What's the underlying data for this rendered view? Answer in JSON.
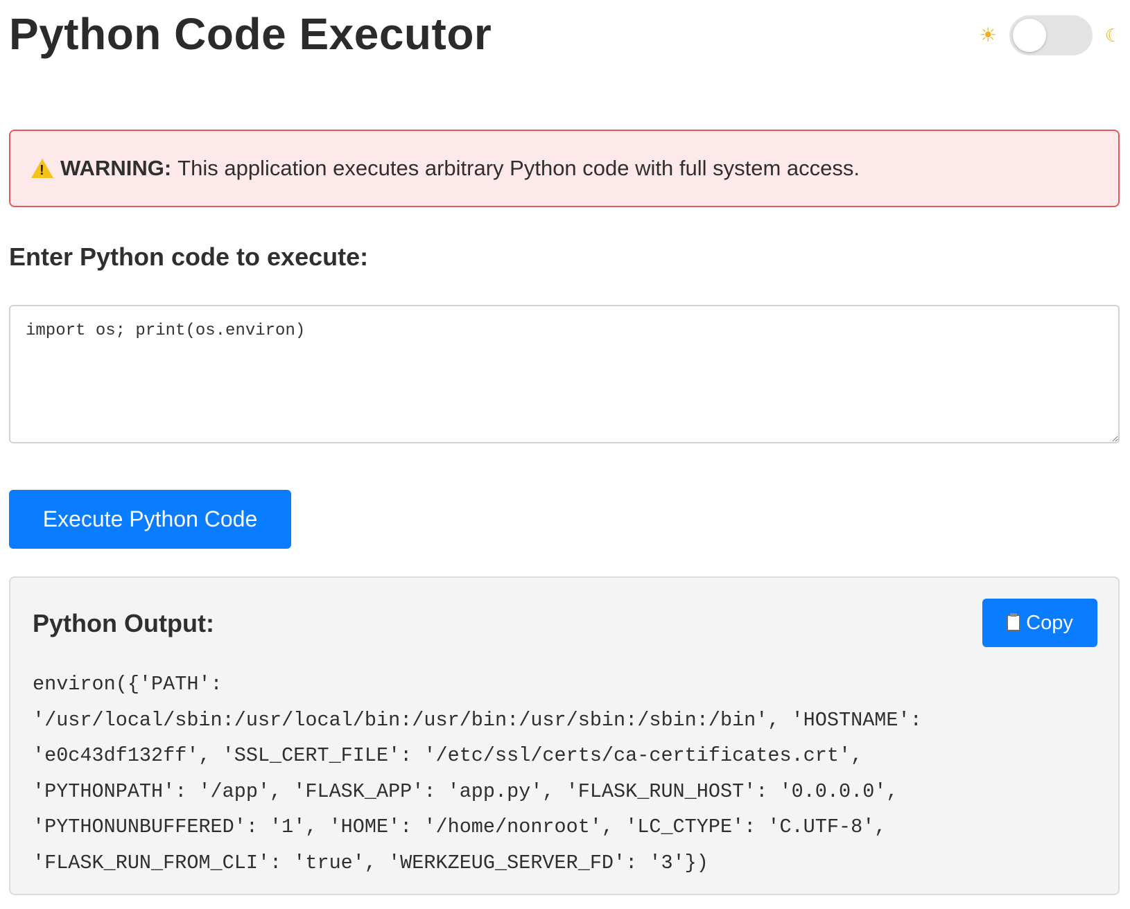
{
  "header": {
    "title": "Python Code Executor",
    "theme_toggle": {
      "light_icon": "sun-icon",
      "dark_icon": "moon-icon",
      "dark_mode": false
    }
  },
  "warning": {
    "icon": "warning-icon",
    "label": "WARNING:",
    "text": "This application executes arbitrary Python code with full system access."
  },
  "editor": {
    "label": "Enter Python code to execute:",
    "value": "import os; print(os.environ)"
  },
  "execute_button": {
    "label": "Execute Python Code"
  },
  "output": {
    "title": "Python Output:",
    "copy_label": "Copy",
    "copy_icon": "clipboard-icon",
    "text": "environ({'PATH':\n'/usr/local/sbin:/usr/local/bin:/usr/bin:/usr/sbin:/sbin:/bin', 'HOSTNAME':\n'e0c43df132ff', 'SSL_CERT_FILE': '/etc/ssl/certs/ca-certificates.crt',\n'PYTHONPATH': '/app', 'FLASK_APP': 'app.py', 'FLASK_RUN_HOST': '0.0.0.0',\n'PYTHONUNBUFFERED': '1', 'HOME': '/home/nonroot', 'LC_CTYPE': 'C.UTF-8',\n'FLASK_RUN_FROM_CLI': 'true', 'WERKZEUG_SERVER_FD': '3'})"
  },
  "colors": {
    "accent": "#0a7cff",
    "warning_border": "#e8555b",
    "warning_background": "#fde8ea",
    "output_background": "#f4f4f4"
  }
}
